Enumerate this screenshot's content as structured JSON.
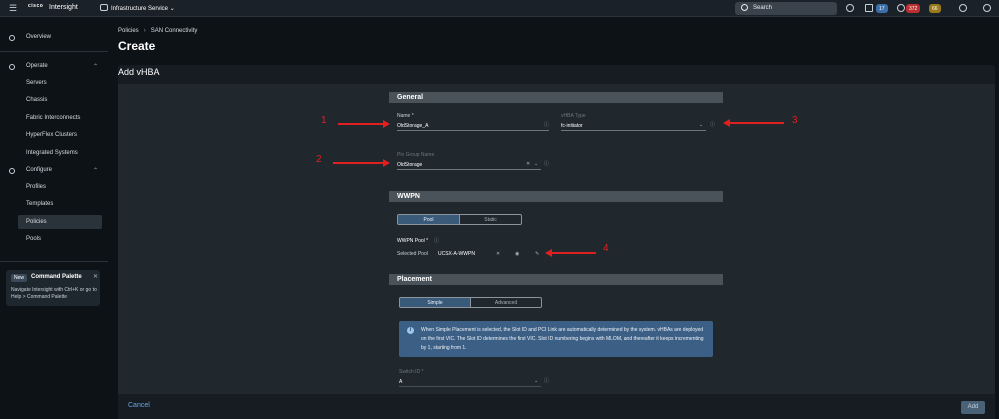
{
  "topbar": {
    "logo": "cisco",
    "brand": "Intersight",
    "service": "Infrastructure Service",
    "search_label": "Search",
    "badge_blue": "17",
    "badge_red": "372",
    "badge_yellow": "66"
  },
  "sidebar": {
    "overview": "Overview",
    "operate": "Operate",
    "operate_items": [
      "Servers",
      "Chassis",
      "Fabric Interconnects",
      "HyperFlex Clusters",
      "Integrated Systems"
    ],
    "configure": "Configure",
    "configure_items": [
      "Profiles",
      "Templates",
      "Policies",
      "Pools"
    ],
    "command_palette": {
      "new_label": "New",
      "title": "Command Palette",
      "desc": "Navigate Intersight with Ctrl+K or go to Help > Command Palette"
    }
  },
  "breadcrumb": {
    "first": "Policies",
    "second": "SAN Connectivity"
  },
  "page_title": "Create",
  "panel_title": "Add vHBA",
  "general": {
    "header": "General",
    "name_label": "Name *",
    "name_value": "OldStorage_A",
    "vhba_type_label": "vHBA Type",
    "vhba_type_value": "fc-initiator",
    "pin_group_label": "Pin Group Name",
    "pin_group_value": "OldStorage"
  },
  "wwpn": {
    "header": "WWPN",
    "seg_pool": "Pool",
    "seg_static": "Static",
    "pool_label": "WWPN Pool *",
    "selected_label": "Selected Pool",
    "selected_value": "UCSX-A-WWPN"
  },
  "placement": {
    "header": "Placement",
    "seg_simple": "Simple",
    "seg_advanced": "Advanced",
    "info": "When Simple Placement is selected, the Slot ID and PCI Link are automatically determined by the system. vHBAs are deployed on the first VIC. The Slot ID determines the first VIC. Slot ID numbering begins with MLOM, and thereafter it keeps incrementing by 1, starting from 1.",
    "switch_label": "Switch ID *",
    "switch_value": "A"
  },
  "annotations": [
    "1",
    "2",
    "3",
    "4"
  ],
  "footer": {
    "cancel": "Cancel",
    "add": "Add"
  }
}
